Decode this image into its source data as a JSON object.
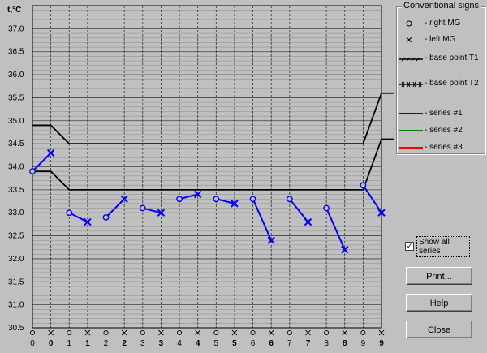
{
  "chart_data": {
    "type": "line",
    "ylabel": "t,°C",
    "ylim": [
      30.5,
      37.5
    ],
    "y_ticks": [
      "37.0",
      "36.5",
      "36.0",
      "35.5",
      "35.0",
      "34.5",
      "34.0",
      "33.5",
      "33.0",
      "32.5",
      "32.0",
      "31.5",
      "31.0",
      "30.5"
    ],
    "x_ticks": [
      {
        "day": "0",
        "bold": false,
        "marker": "right"
      },
      {
        "day": "0",
        "bold": true,
        "marker": "left"
      },
      {
        "day": "1",
        "bold": false,
        "marker": "right"
      },
      {
        "day": "1",
        "bold": true,
        "marker": "left"
      },
      {
        "day": "2",
        "bold": false,
        "marker": "right"
      },
      {
        "day": "2",
        "bold": true,
        "marker": "left"
      },
      {
        "day": "3",
        "bold": false,
        "marker": "right"
      },
      {
        "day": "3",
        "bold": true,
        "marker": "left"
      },
      {
        "day": "4",
        "bold": false,
        "marker": "right"
      },
      {
        "day": "4",
        "bold": true,
        "marker": "left"
      },
      {
        "day": "5",
        "bold": false,
        "marker": "right"
      },
      {
        "day": "5",
        "bold": true,
        "marker": "left"
      },
      {
        "day": "6",
        "bold": false,
        "marker": "right"
      },
      {
        "day": "6",
        "bold": true,
        "marker": "left"
      },
      {
        "day": "7",
        "bold": false,
        "marker": "right"
      },
      {
        "day": "7",
        "bold": true,
        "marker": "left"
      },
      {
        "day": "8",
        "bold": false,
        "marker": "right"
      },
      {
        "day": "8",
        "bold": true,
        "marker": "left"
      },
      {
        "day": "9",
        "bold": false,
        "marker": "right"
      },
      {
        "day": "9",
        "bold": true,
        "marker": "left"
      }
    ],
    "grid": true,
    "base_point_T1": [
      [
        0,
        34.9
      ],
      [
        1,
        34.9
      ],
      [
        2,
        34.5
      ],
      [
        18,
        34.5
      ],
      [
        19,
        35.6
      ],
      [
        20,
        35.6
      ]
    ],
    "base_point_T2": [
      [
        0,
        33.9
      ],
      [
        1,
        33.9
      ],
      [
        2,
        33.5
      ],
      [
        18,
        33.5
      ],
      [
        19,
        34.6
      ],
      [
        20,
        34.6
      ]
    ],
    "series": [
      {
        "color": "#0000ff",
        "pairs": [
          [
            {
              "i": 0,
              "t": 33.9
            },
            {
              "i": 1,
              "t": 34.3
            }
          ],
          [
            {
              "i": 2,
              "t": 33.0
            },
            {
              "i": 3,
              "t": 32.8
            }
          ],
          [
            {
              "i": 4,
              "t": 32.9
            },
            {
              "i": 5,
              "t": 33.3
            }
          ],
          [
            {
              "i": 6,
              "t": 33.1
            },
            {
              "i": 7,
              "t": 33.0
            }
          ],
          [
            {
              "i": 8,
              "t": 33.3
            },
            {
              "i": 9,
              "t": 33.4
            }
          ],
          [
            {
              "i": 10,
              "t": 33.3
            },
            {
              "i": 11,
              "t": 33.2
            }
          ],
          [
            {
              "i": 12,
              "t": 33.3
            },
            {
              "i": 13,
              "t": 32.4
            }
          ],
          [
            {
              "i": 14,
              "t": 33.3
            },
            {
              "i": 15,
              "t": 32.8
            }
          ],
          [
            {
              "i": 16,
              "t": 33.1
            },
            {
              "i": 17,
              "t": 32.2
            }
          ],
          [
            {
              "i": 18,
              "t": 33.6
            },
            {
              "i": 19,
              "t": 33.0
            }
          ]
        ]
      }
    ]
  },
  "legend": {
    "title": "Conventional signs",
    "items": [
      {
        "icon": "circle-marker-icon",
        "label": "- right MG"
      },
      {
        "icon": "cross-marker-icon",
        "label": "- left MG"
      },
      {
        "icon": "base-point-t1-line-icon",
        "label": "- base point T1"
      },
      {
        "icon": "base-point-t2-line-icon",
        "label": "- base point T2"
      },
      {
        "icon": "series-1-line-icon",
        "label": "- series #1",
        "color": "#0000ff"
      },
      {
        "icon": "series-2-line-icon",
        "label": "- series #2",
        "color": "#008000"
      },
      {
        "icon": "series-3-line-icon",
        "label": "- series #3",
        "color": "#ff0000"
      }
    ]
  },
  "show_all": {
    "label": "Show all series",
    "checked": true,
    "check_glyph": "✓"
  },
  "buttons": {
    "print": "Print...",
    "help": "Help",
    "close": "Close"
  }
}
